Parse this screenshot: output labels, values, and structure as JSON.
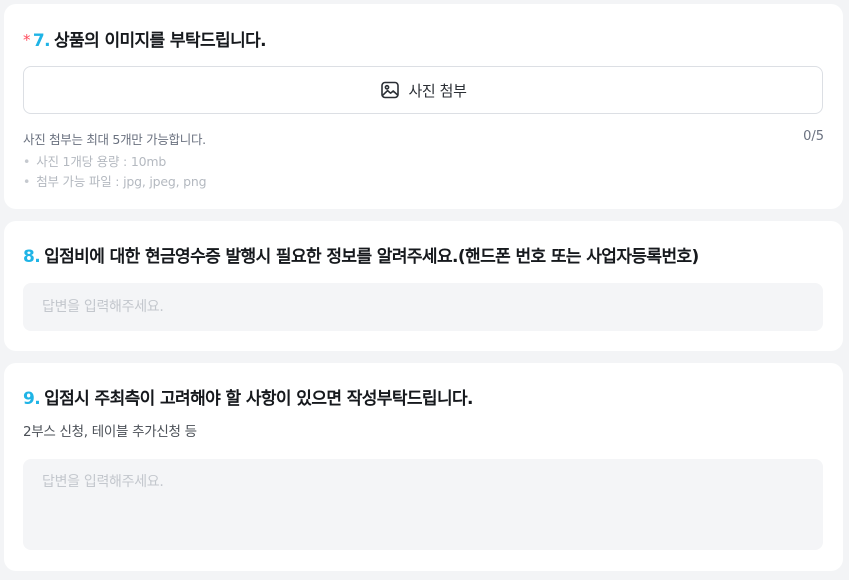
{
  "questions": [
    {
      "required_mark": "*",
      "number": "7.",
      "title": "상품의 이미지를 부탁드립니다.",
      "upload_button_label": "사진 첨부",
      "upload_icon": "image-icon",
      "note": "사진 첨부는 최대 5개만 가능합니다.",
      "count": "0/5",
      "bullets": [
        "사진 1개당 용량 : 10mb",
        "첨부 가능 파일 : jpg, jpeg, png"
      ]
    },
    {
      "number": "8.",
      "title": "입점비에 대한 현금영수증 발행시 필요한 정보를 알려주세요.(핸드폰 번호 또는 사업자등록번호)",
      "placeholder": "답변을 입력해주세요."
    },
    {
      "number": "9.",
      "title": "입점시 주최측이 고려해야 할 사항이 있으면 작성부탁드립니다.",
      "description": "2부스 신청, 테이블 추가신청 등",
      "placeholder": "답변을 입력해주세요."
    }
  ],
  "colors": {
    "accent": "#1fb4e6",
    "required": "#ff4d5e",
    "background": "#f3f4f6",
    "input_bg": "#f4f5f7"
  }
}
